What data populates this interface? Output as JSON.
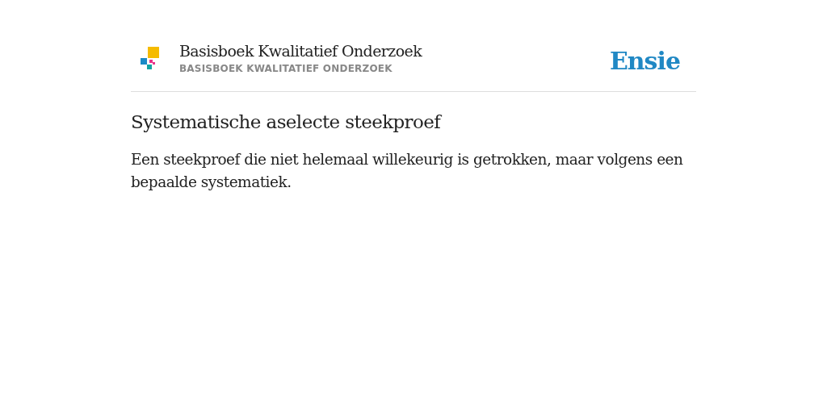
{
  "header": {
    "title": "Basisboek Kwalitatief Onderzoek",
    "subtitle": "BASISBOEK KWALITATIEF ONDERZOEK",
    "brand": "Ensie"
  },
  "entry": {
    "term": "Systematische aselecte steekproef",
    "definition": "Een steekproef die niet helemaal willekeurig is getrokken, maar volgens een bepaalde systematiek."
  }
}
